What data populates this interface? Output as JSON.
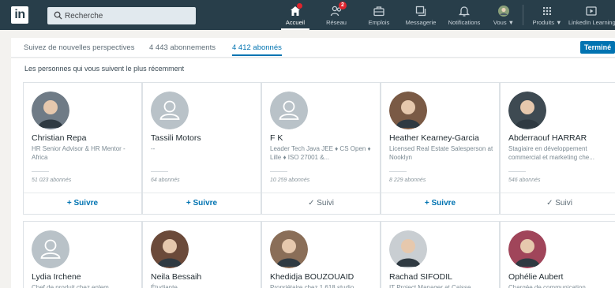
{
  "nav": {
    "logo_text": "in",
    "search_placeholder": "Recherche",
    "items": [
      {
        "label": "Accueil",
        "icon": "home-icon",
        "badge": ""
      },
      {
        "label": "Réseau",
        "icon": "network-icon",
        "badge": "2"
      },
      {
        "label": "Emplois",
        "icon": "jobs-icon",
        "badge": ""
      },
      {
        "label": "Messagerie",
        "icon": "messaging-icon",
        "badge": ""
      },
      {
        "label": "Notifications",
        "icon": "bell-icon",
        "badge": ""
      },
      {
        "label": "Vous ▼",
        "icon": "profile-avatar",
        "badge": ""
      },
      {
        "label": "Produits ▼",
        "icon": "grid-icon",
        "badge": ""
      },
      {
        "label": "LinkedIn Learning",
        "icon": "learning-icon",
        "badge": ""
      }
    ]
  },
  "subnav": {
    "tabs": [
      {
        "label": "Suivez de nouvelles perspectives"
      },
      {
        "label": "4 443 abonnements"
      },
      {
        "label": "4 412 abonnés"
      }
    ],
    "done_label": "Terminé"
  },
  "section_title": "Les personnes qui vous suivent le plus récemment",
  "cards_row1": [
    {
      "name": "Christian Repa",
      "headline": "HR Senior Advisor & HR Mentor - Africa",
      "followers": "51 023 abonnés",
      "action": "+ Suivre",
      "state": "follow",
      "avatar": "photo",
      "color": "#6f7b86"
    },
    {
      "name": "Tassili Motors",
      "headline": "--",
      "followers": "64 abonnés",
      "action": "+ Suivre",
      "state": "follow",
      "avatar": "ghost",
      "color": "#b9c2c8"
    },
    {
      "name": "F K",
      "headline": "Leader Tech Java JEE ♦ CS Open ♦ Lille ♦ ISO 27001 &...",
      "followers": "10 259 abonnés",
      "action": "✓ Suivi",
      "state": "followed",
      "avatar": "ghost",
      "color": "#b9c2c8"
    },
    {
      "name": "Heather Kearney-Garcia",
      "headline": "Licensed Real Estate Salesperson at Nooklyn",
      "followers": "8 229 abonnés",
      "action": "+ Suivre",
      "state": "follow",
      "avatar": "photo",
      "color": "#7a5a45"
    },
    {
      "name": "Abderraouf HARRAR",
      "headline": "Stagiaire en développement commercial et marketing che...",
      "followers": "546 abonnés",
      "action": "✓ Suivi",
      "state": "followed",
      "avatar": "photo",
      "color": "#3e4a52"
    }
  ],
  "cards_row2": [
    {
      "name": "Lydia Irchene",
      "headline": "Chef de produit chez enlem",
      "avatar": "ghost",
      "color": "#b9c2c8"
    },
    {
      "name": "Neila Bessaih",
      "headline": "Étudiante",
      "avatar": "photo",
      "color": "#6b4a3a"
    },
    {
      "name": "Khedidja BOUZOUAID",
      "headline": "Propriétaire chez 1.618 studio",
      "avatar": "photo",
      "color": "#8a6e58"
    },
    {
      "name": "Rachad SIFODIL",
      "headline": "IT Project Manager at Caisse",
      "avatar": "photo",
      "color": "#c9ced2"
    },
    {
      "name": "Ophélie Aubert",
      "headline": "Chargée de communication",
      "avatar": "photo",
      "color": "#a0455a"
    }
  ],
  "colors": {
    "nav_bg": "#283e4a",
    "accent": "#0073b1",
    "badge": "#e0242d"
  }
}
